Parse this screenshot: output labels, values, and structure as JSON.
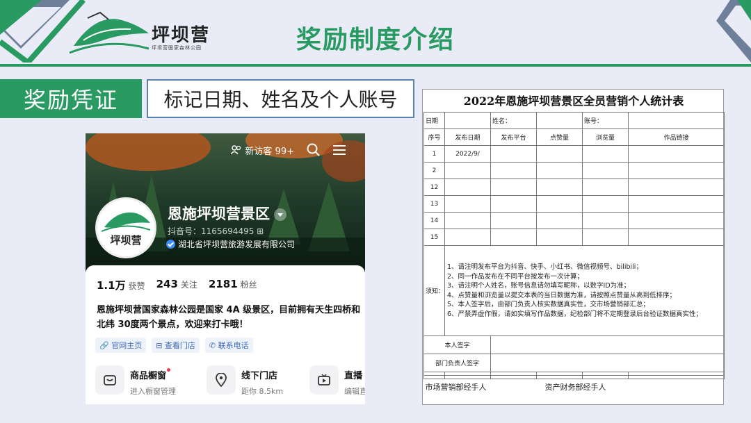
{
  "header": {
    "title": "奖励制度介绍",
    "logo_name": "坪坝营",
    "logo_sub": "坪坝营国家森林公园"
  },
  "section": {
    "tag": "奖励凭证",
    "desc": "标记日期、姓名及个人账号"
  },
  "phone": {
    "visitors": "新访客 99+",
    "name": "恩施坪坝营景区",
    "account_id": "抖音号：1165694495 ⊞",
    "verified": "湖北省坪坝营旅游发展有限公司",
    "avatar_text": "坪坝营",
    "stats": [
      {
        "value": "1.1万",
        "label": "获赞"
      },
      {
        "value": "243",
        "label": "关注"
      },
      {
        "value": "2181",
        "label": "粉丝"
      }
    ],
    "description": "恩施坪坝营国家森林公园是国家 4A 级景区，目前拥有天生四桥和北纬 30度两个景点，欢迎来打卡哦！",
    "links": [
      "官网主页",
      "查看门店",
      "联系电话"
    ],
    "services": [
      {
        "title": "商品橱窗",
        "sub": "进入橱窗管理"
      },
      {
        "title": "线下门店",
        "sub": "距你 8.5km"
      },
      {
        "title": "直播",
        "sub": "编辑直"
      }
    ]
  },
  "form": {
    "title": "2022年恩施坪坝营景区全员营销个人统计表",
    "row_date": "日期",
    "row_name": "姓名：",
    "row_account": "账号：",
    "headers": [
      "序号",
      "发布日期",
      "发布平台",
      "点赞量",
      "浏览量",
      "作品链接"
    ],
    "rows": [
      {
        "no": "1",
        "date": "2022/9/"
      },
      {
        "no": "2",
        "date": ""
      },
      {
        "no": "12",
        "date": ""
      },
      {
        "no": "13",
        "date": ""
      },
      {
        "no": "14",
        "date": ""
      },
      {
        "no": "15",
        "date": ""
      }
    ],
    "notes_label": "须知：",
    "notes": [
      "1、请注明发布平台为抖音、快手、小红书、微信视频号、bilibili；",
      "2、同一作品发布在不同平台按发布一次计算；",
      "3、请注明个人姓名，账号信息请勿填写昵称，以数字ID为准；",
      "4、点赞量和浏览量以提交本表的当日数据为准，请按照点赞量从高到低排序；",
      "5、本人签字后，由部门负责人核实数据真实性，交市场营销部汇总；",
      "6、严禁弄虚作假，请如实填写作品数据，纪检部门将不定期登录后台验证数据真实性；"
    ],
    "sign_self": "本人签字",
    "sign_head": "部门负责人签字",
    "footer_left": "市场营销部经手人",
    "footer_right": "资产财务部经手人"
  },
  "colors": {
    "accent": "#2a9a63",
    "border_blue": "#5a82b0",
    "background": "#e9ecf6"
  }
}
